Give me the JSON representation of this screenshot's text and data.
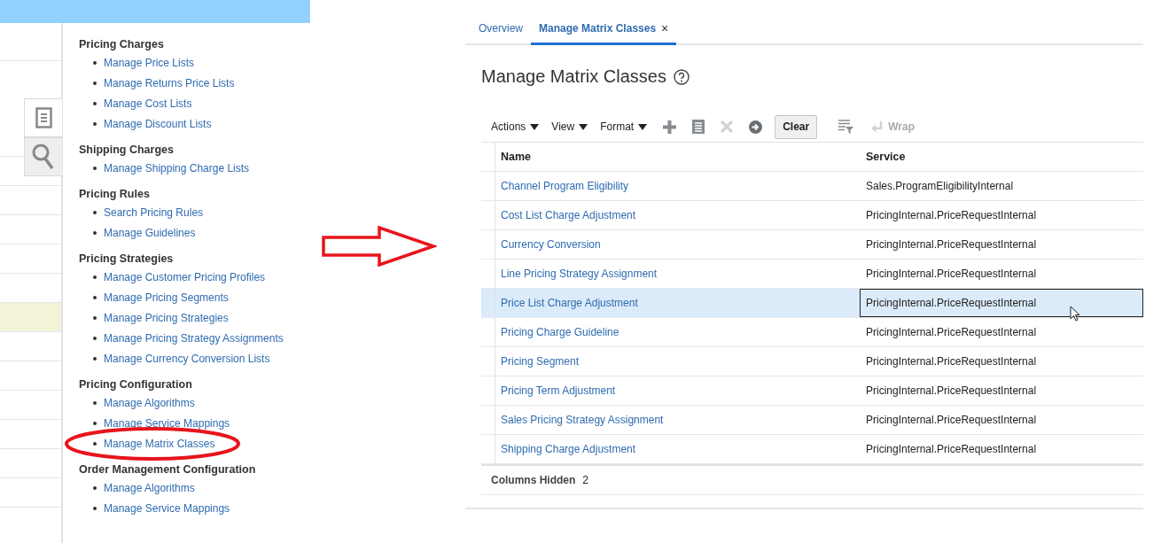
{
  "background_list": {
    "rows": [
      {
        "highlighted": false
      },
      {
        "highlighted": false
      },
      {
        "highlighted": false
      },
      {
        "highlighted": false
      },
      {
        "highlighted": false
      },
      {
        "highlighted": false
      },
      {
        "highlighted": false
      },
      {
        "highlighted": true
      },
      {
        "highlighted": false
      },
      {
        "highlighted": false
      },
      {
        "highlighted": false
      },
      {
        "highlighted": false
      },
      {
        "highlighted": false
      },
      {
        "highlighted": false
      }
    ]
  },
  "side_tabs": [
    {
      "kind": "tasks",
      "selected": true
    },
    {
      "kind": "search",
      "selected": false
    }
  ],
  "task_panel": {
    "sections": [
      {
        "heading": "Pricing Charges",
        "items": [
          {
            "label": "Manage Price Lists",
            "circled": false
          },
          {
            "label": "Manage Returns Price Lists",
            "circled": false
          },
          {
            "label": "Manage Cost Lists",
            "circled": false
          },
          {
            "label": "Manage Discount Lists",
            "circled": false
          }
        ]
      },
      {
        "heading": "Shipping Charges",
        "items": [
          {
            "label": "Manage Shipping Charge Lists",
            "circled": false
          }
        ]
      },
      {
        "heading": "Pricing Rules",
        "items": [
          {
            "label": "Search Pricing Rules",
            "circled": false
          },
          {
            "label": "Manage Guidelines",
            "circled": false
          }
        ]
      },
      {
        "heading": "Pricing Strategies",
        "items": [
          {
            "label": "Manage Customer Pricing Profiles",
            "circled": false
          },
          {
            "label": "Manage Pricing Segments",
            "circled": false
          },
          {
            "label": "Manage Pricing Strategies",
            "circled": false
          },
          {
            "label": "Manage Pricing Strategy Assignments",
            "circled": false
          },
          {
            "label": "Manage Currency Conversion Lists",
            "circled": false
          }
        ]
      },
      {
        "heading": "Pricing Configuration",
        "items": [
          {
            "label": "Manage Algorithms",
            "circled": false
          },
          {
            "label": "Manage Service Mappings",
            "circled": false
          },
          {
            "label": "Manage Matrix Classes",
            "circled": true
          }
        ]
      },
      {
        "heading": "Order Management Configuration",
        "items": [
          {
            "label": "Manage Algorithms",
            "circled": false
          },
          {
            "label": "Manage Service Mappings",
            "circled": false
          }
        ]
      }
    ]
  },
  "tabs": [
    {
      "label": "Overview",
      "selected": false
    },
    {
      "label": "Manage Matrix Classes",
      "selected": true,
      "close": "×"
    }
  ],
  "page_title": "Manage Matrix Classes",
  "toolbar": {
    "menus": [
      "Actions",
      "View",
      "Format"
    ],
    "tools": [
      {
        "kind": "add",
        "disabled": false
      },
      {
        "kind": "duplicate",
        "disabled": false
      },
      {
        "kind": "delete",
        "disabled": true
      },
      {
        "kind": "go",
        "disabled": false
      },
      {
        "kind": "clear",
        "label": "Clear",
        "disabled": false
      },
      {
        "kind": "filter",
        "disabled": false
      },
      {
        "kind": "wrap",
        "label": "Wrap",
        "disabled": true
      }
    ]
  },
  "table": {
    "columns": [
      "Name",
      "Service"
    ],
    "rows": [
      {
        "name": "Channel Program Eligibility",
        "service": "Sales.ProgramEligibilityInternal",
        "selected": false
      },
      {
        "name": "Cost List Charge Adjustment",
        "service": "PricingInternal.PriceRequestInternal",
        "selected": false
      },
      {
        "name": "Currency Conversion",
        "service": "PricingInternal.PriceRequestInternal",
        "selected": false
      },
      {
        "name": "Line Pricing Strategy Assignment",
        "service": "PricingInternal.PriceRequestInternal",
        "selected": false
      },
      {
        "name": "Price List Charge Adjustment",
        "service": "PricingInternal.PriceRequestInternal",
        "selected": true
      },
      {
        "name": "Pricing Charge Guideline",
        "service": "PricingInternal.PriceRequestInternal",
        "selected": false
      },
      {
        "name": "Pricing Segment",
        "service": "PricingInternal.PriceRequestInternal",
        "selected": false
      },
      {
        "name": "Pricing Term Adjustment",
        "service": "PricingInternal.PriceRequestInternal",
        "selected": false
      },
      {
        "name": "Sales Pricing Strategy Assignment",
        "service": "PricingInternal.PriceRequestInternal",
        "selected": false
      },
      {
        "name": "Shipping Charge Adjustment",
        "service": "PricingInternal.PriceRequestInternal",
        "selected": false
      }
    ]
  },
  "footer": {
    "label": "Columns Hidden",
    "value": "2"
  }
}
